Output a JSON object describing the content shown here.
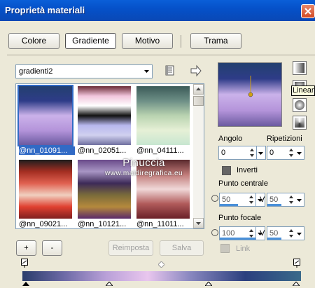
{
  "window": {
    "title": "Proprietà materiali"
  },
  "tabs": [
    {
      "label": "Colore"
    },
    {
      "label": "Gradiente",
      "active": true
    },
    {
      "label": "Motivo"
    },
    {
      "label": "Trama"
    }
  ],
  "gradient_combo": {
    "value": "gradienti2"
  },
  "gradients": [
    {
      "name": "@nn_01091...",
      "selected": true,
      "colors": [
        "#23406f",
        "#2e3c88",
        "#cbb2ea",
        "#b494da",
        "#6b5aa0"
      ]
    },
    {
      "name": "@nn_02051...",
      "selected": false,
      "colors": [
        "#6a2a35",
        "#f1c5dc",
        "#ffffff",
        "#111111",
        "#b8b8ef",
        "#d0d0ef",
        "#7070a0"
      ]
    },
    {
      "name": "@nn_04111...",
      "selected": false,
      "colors": [
        "#3b5a58",
        "#6d8f86",
        "#b9d3b0",
        "#e6f0d6",
        "#c7e6d0"
      ]
    },
    {
      "name": "@nn_09021...",
      "selected": false,
      "colors": [
        "#1e1e1e",
        "#a42e22",
        "#e06050",
        "#f0d0c0",
        "#e04030",
        "#802020"
      ]
    },
    {
      "name": "@nn_10121...",
      "selected": false,
      "colors": [
        "#6a4a8a",
        "#a895c4",
        "#3d2a58",
        "#7a6b3a",
        "#b5893c",
        "#5a2a6a"
      ]
    },
    {
      "name": "@nn_11011...",
      "selected": false,
      "colors": [
        "#5a2a2e",
        "#c07a78",
        "#f0d8d8",
        "#b05a5a",
        "#6a2028"
      ]
    }
  ],
  "angle": {
    "label": "Angolo",
    "value": "0"
  },
  "repeats": {
    "label": "Ripetizioni",
    "value": "0"
  },
  "invert": {
    "label": "Inverti"
  },
  "center_point": {
    "label": "Punto centrale",
    "h": "50",
    "v_label": "V",
    "v": "50"
  },
  "focal_point": {
    "label": "Punto focale",
    "h": "100",
    "v_label": "V",
    "v": "50"
  },
  "link": {
    "label": "Link"
  },
  "tooltip": {
    "text": "Lineare"
  },
  "buttons": {
    "add": "+",
    "remove": "-",
    "reset": "Reimposta",
    "save": "Salva"
  },
  "watermark": {
    "line1": "Pinuccia",
    "line2": "www.maidiregrafica.eu"
  },
  "accent": "#0a5fd8"
}
